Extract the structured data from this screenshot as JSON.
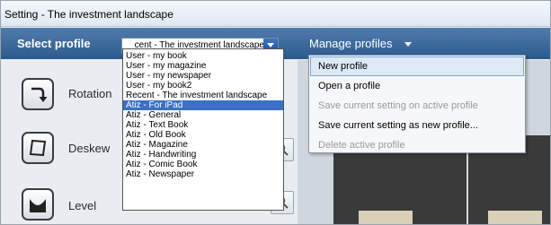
{
  "window": {
    "title": "Setting - The investment landscape"
  },
  "header": {
    "select_profile_label": "Select profile",
    "profile_combo_value": "cent - The investment landscape",
    "manage_profiles_label": "Manage profiles"
  },
  "profiles": {
    "items": [
      "User - my book",
      "User - my magazine",
      "User - my newspaper",
      "User - my book2",
      "Recent - The investment landscape",
      "Atiz - For iPad",
      "Atiz - General",
      "Atiz - Text Book",
      "Atiz - Old Book",
      "Atiz - Magazine",
      "Atiz - Handwriting",
      "Atiz - Comic Book",
      "Atiz - Newspaper"
    ],
    "selected": "Atiz - For iPad"
  },
  "tools": {
    "rotation": "Rotation",
    "deskew": "Deskew",
    "level": "Level"
  },
  "manage_menu": {
    "items": [
      "New profile",
      "Open a profile",
      "Save current setting on active profile",
      "Save current setting as new profile...",
      "Delete active profile"
    ],
    "highlighted": "New profile",
    "disabled": [
      "Save current setting on active profile",
      "Delete active profile"
    ]
  },
  "colors": {
    "header_blue": "#2d5a8c",
    "selection_blue": "#3b70c4",
    "menu_hover": "#dce9f7"
  }
}
